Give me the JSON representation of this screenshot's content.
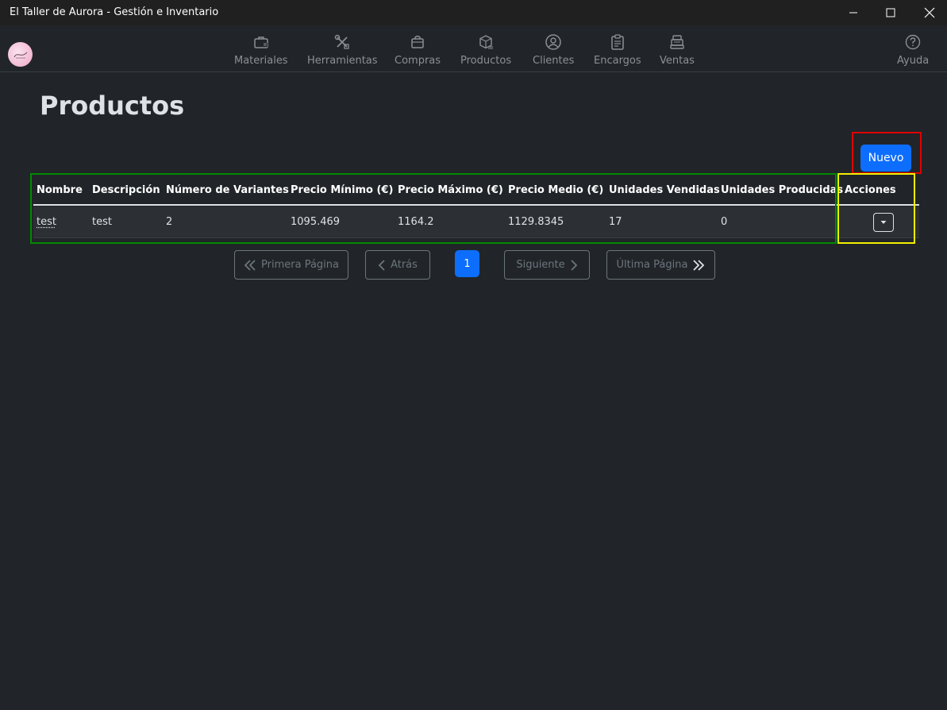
{
  "window": {
    "title": "El Taller de Aurora - Gestión e Inventario"
  },
  "nav": {
    "items": [
      {
        "label": "Materiales",
        "icon": "briefcase-icon"
      },
      {
        "label": "Herramientas",
        "icon": "tools-icon"
      },
      {
        "label": "Compras",
        "icon": "shopping-bag-icon"
      },
      {
        "label": "Productos",
        "icon": "box-icon"
      },
      {
        "label": "Clientes",
        "icon": "user-circle-icon"
      },
      {
        "label": "Encargos",
        "icon": "clipboard-icon"
      },
      {
        "label": "Ventas",
        "icon": "cash-register-icon"
      }
    ],
    "help": {
      "label": "Ayuda",
      "icon": "question-circle-icon"
    }
  },
  "page": {
    "title": "Productos",
    "new_button": "Nuevo"
  },
  "table": {
    "columns": [
      "Nombre",
      "Descripción",
      "Número de Variantes",
      "Precio Mínimo (€)",
      "Precio Máximo (€)",
      "Precio Medio (€)",
      "Unidades Vendidas",
      "Unidades Producidas",
      "Acciones"
    ],
    "rows": [
      {
        "nombre": "test",
        "descripcion": "test",
        "variantes": "2",
        "precio_min": "1095.469",
        "precio_max": "1164.2",
        "precio_medio": "1129.8345",
        "vendidas": "17",
        "producidas": "0"
      }
    ]
  },
  "pagination": {
    "first": "Primera Página",
    "prev": "Atrás",
    "current": "1",
    "next": "Siguiente",
    "last": "Última Página"
  },
  "colors": {
    "background": "#212529",
    "primary": "#0d6efd",
    "highlight_red": "#e00000",
    "highlight_green": "#008a00",
    "highlight_yellow": "#f0f000"
  }
}
